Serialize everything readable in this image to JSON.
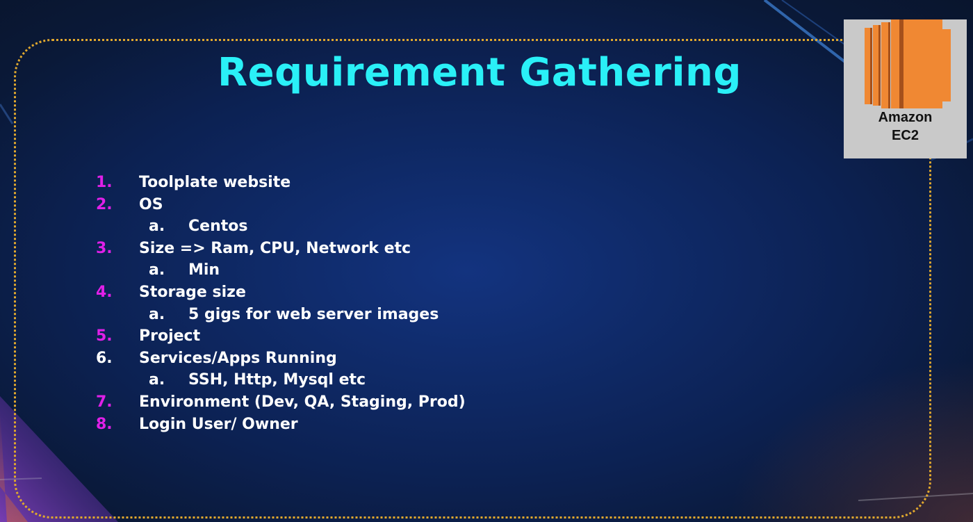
{
  "slide": {
    "title": "Requirement Gathering",
    "colors": {
      "title": "#2af0f7",
      "accent_number": "#e020e8",
      "text": "#ffffff",
      "frame": "#e0a82e",
      "background": "#0c2152"
    },
    "items": [
      {
        "num": "1.",
        "label": "Toolplate website",
        "num_color": "#e020e8",
        "subs": []
      },
      {
        "num": "2.",
        "label": "OS",
        "num_color": "#e020e8",
        "subs": [
          {
            "letter": "a.",
            "label": "Centos"
          }
        ]
      },
      {
        "num": "3.",
        "label": "Size => Ram, CPU, Network etc",
        "num_color": "#e020e8",
        "subs": [
          {
            "letter": "a.",
            "label": "Min"
          }
        ]
      },
      {
        "num": "4.",
        "label": "Storage size",
        "num_color": "#e020e8",
        "subs": [
          {
            "letter": "a.",
            "label": "5 gigs for web server images"
          }
        ]
      },
      {
        "num": "5.",
        "label": "Project",
        "num_color": "#e020e8",
        "subs": []
      },
      {
        "num": "6.",
        "label": "Services/Apps Running",
        "num_color": "#ffffff",
        "subs": [
          {
            "letter": "a.",
            "label": "SSH, Http, Mysql etc"
          }
        ]
      },
      {
        "num": "7.",
        "label": "Environment (Dev, QA, Staging, Prod)",
        "num_color": "#e020e8",
        "subs": []
      },
      {
        "num": "8.",
        "label": "Login User/ Owner",
        "num_color": "#e020e8",
        "subs": []
      }
    ]
  },
  "ec2_logo": {
    "icon": "amazon-ec2-icon",
    "line1": "Amazon",
    "line2": "EC2",
    "color": "#f08833"
  }
}
